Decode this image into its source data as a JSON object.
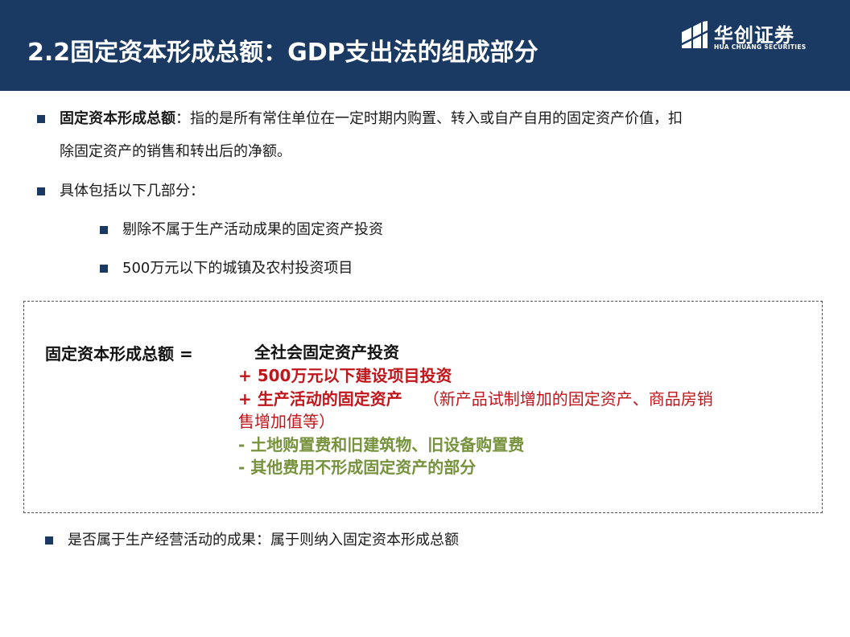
{
  "header": {
    "title": "2.2固定资本形成总额：GDP支出法的组成部分",
    "logo_cn": "华创证券",
    "logo_en": "HUA CHUANG SECURITIES"
  },
  "bullets": {
    "b1_term": "固定资本形成总额",
    "b1_line1": "：指的是所有常住单位在一定时期内购置、转入或自产自用的固定资产价值，扣",
    "b1_line2": "除固定资产的销售和转出后的净额。",
    "b2": "具体包括以下几部分：",
    "sub1": "剔除不属于生产活动成果的固定资产投资",
    "sub2": "500万元以下的城镇及农村投资项目",
    "b3": "是否属于生产经营活动的成果：属于则纳入固定资本形成总额"
  },
  "formula": {
    "label": "固定资本形成总额 =",
    "line1": "全社会固定资产投资",
    "line2": "+ 500万元以下建设项目投资",
    "line3_main": "+ 生产活动的固定资产",
    "line3_note": "（新产品试制增加的固定资产、商品房销",
    "line4": "售增加值等）",
    "line5": "- 土地购置费和旧建筑物、旧设备购置费",
    "line6": "- 其他费用不形成固定资产的部分"
  },
  "colors": {
    "header_bg": "#1b3a63",
    "red": "#c0161b",
    "green": "#76923c"
  }
}
